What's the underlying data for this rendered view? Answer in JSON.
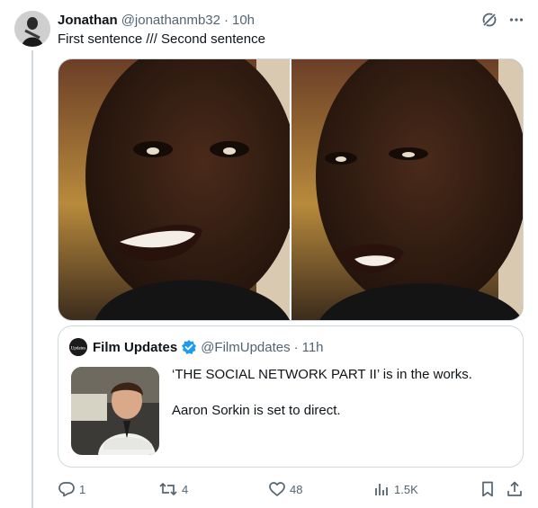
{
  "tweet": {
    "author_name": "Jonathan",
    "author_handle": "@jonathanmb32",
    "separator": "·",
    "time": "10h",
    "text": "First sentence /// Second sentence"
  },
  "top_icons": [
    "grok-icon",
    "more-icon"
  ],
  "media": {
    "images": [
      "smiling-face-image",
      "disappointed-face-image"
    ]
  },
  "quote": {
    "author_name": "Film Updates",
    "author_handle": "@FilmUpdates",
    "separator": "·",
    "time": "11h",
    "lines": [
      "‘THE SOCIAL NETWORK PART II’ is in the works.",
      "Aaron Sorkin is set to direct."
    ],
    "avatar_text": "Updates"
  },
  "actions": {
    "replies": "1",
    "reposts": "4",
    "likes": "48",
    "views": "1.5K"
  },
  "colors": {
    "text": "#0f1419",
    "secondary": "#536471",
    "border": "#cfd9de",
    "verified": "#1d9bf0"
  }
}
